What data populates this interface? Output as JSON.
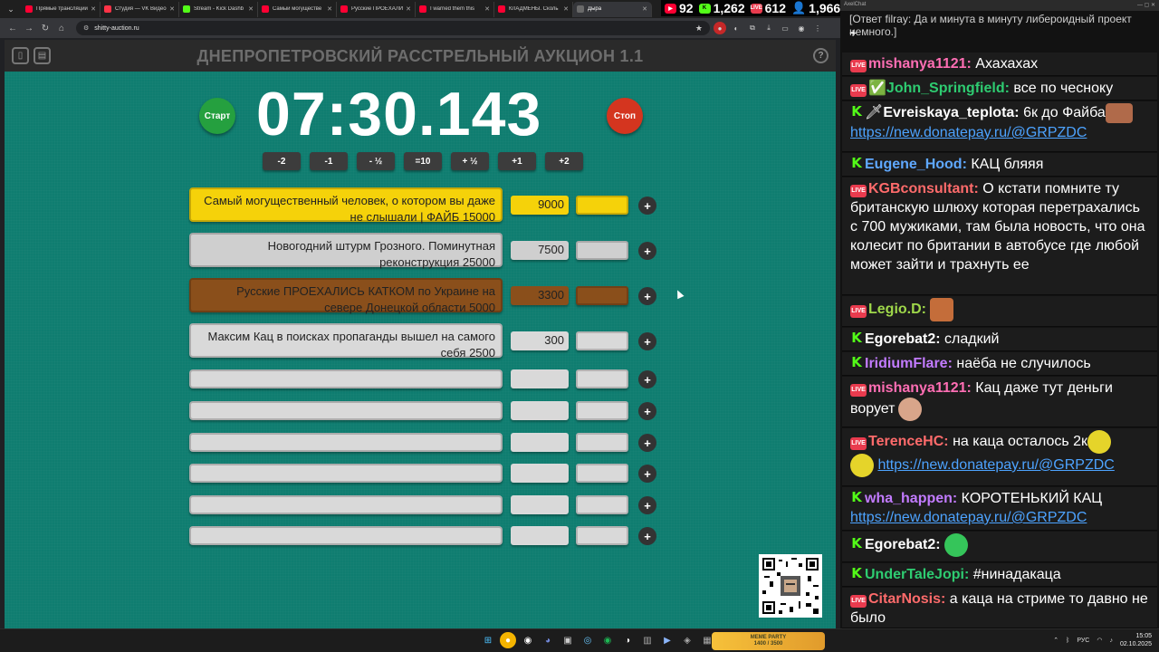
{
  "browser": {
    "tabs": [
      {
        "label": "Прямые трансляции",
        "favicon_color": "#ff0033"
      },
      {
        "label": "Студия — VK Видео",
        "favicon_color": "#ff3347"
      },
      {
        "label": "Stream - Kick Dashb",
        "favicon_color": "#53fc18"
      },
      {
        "label": "Самый могуществе",
        "favicon_color": "#ff0033"
      },
      {
        "label": "Русские ПРОЕХАЛИ",
        "favicon_color": "#ff0033"
      },
      {
        "label": "I warned them this",
        "favicon_color": "#ff0033"
      },
      {
        "label": "КЛАДМЕНЫ. Сколь",
        "favicon_color": "#ff0033"
      },
      {
        "label": "Дыра",
        "favicon_color": "#6a6a6a"
      }
    ],
    "url": "shitty-auction.ru"
  },
  "overlay": {
    "yt_count": "92",
    "kick_count": "1,262",
    "vk_count": "612",
    "total_count": "1,966"
  },
  "auction": {
    "title": "ДНЕПРОПЕТРОВСКИЙ РАССТРЕЛЬНЫЙ АУКЦИОН 1.1",
    "timer": "07:30.143",
    "start_label": "Старт",
    "stop_label": "Стоп",
    "adjust_buttons": [
      "-2",
      "-1",
      "- ½",
      "=10",
      "+ ½",
      "+1",
      "+2"
    ],
    "lots": [
      {
        "name": "Самый могущественный человек, о котором вы даже не слышали | ФАЙБ 15000",
        "amount": "9000",
        "color": "#f5d20a"
      },
      {
        "name": "Новогодний штурм Грозного. Поминутная реконструкция 25000",
        "amount": "7500",
        "color": "#cfcfcf"
      },
      {
        "name": "Русские ПРОЕХАЛИСЬ КАТКОМ по Украине на севере Донецкой области 5000",
        "amount": "3300",
        "color": "#8a4f1b"
      },
      {
        "name": "Максим Кац в поисках пропаганды вышел на самого себя 2500",
        "amount": "300",
        "color": "#d9d9d9"
      }
    ],
    "empty_rows": 6,
    "plus_label": "+"
  },
  "chat": {
    "window_title": "AxelChat",
    "top_line": "[Ответ filray: Да и минута в минуту либероидный проект немного.]",
    "plus_line": "+",
    "live_label": "LIVE",
    "kick_label": "K",
    "messages": [
      {
        "user": "mishanya1121:",
        "text": " Ахахахах",
        "color": "#ff6eb4",
        "platform": "yt"
      },
      {
        "user": "John_Springfield:",
        "text": " все по чесноку",
        "color": "#2ecc71",
        "platform": "yt",
        "pre": "✅"
      },
      {
        "user": "Evreiskaya_teplota:",
        "text": " 6к до Файба",
        "link": "https://new.donatepay.ru/@GRPZDC",
        "color": "#ffffff",
        "platform": "kick",
        "pre": "🗡"
      },
      {
        "user": "Eugene_Hood:",
        "text": " КАЦ бляяя",
        "color": "#5fa8ff",
        "platform": "kick"
      },
      {
        "user": "KGBconsultant:",
        "text": " О кстати помните ту британскую шлюху которая перетрахались с 700 мужиками, там была новость, что она колесит по британии в автобусе где любой может зайти и трахнуть ее",
        "color": "#ff6b6b",
        "platform": "yt"
      },
      {
        "user": "Legio.D:",
        "text": "",
        "color": "#9fd84a",
        "platform": "yt"
      },
      {
        "user": "Egorebat2:",
        "text": " сладкий",
        "color": "#ffffff",
        "platform": "kick"
      },
      {
        "user": "IridiumFlare:",
        "text": " наёба не случилось",
        "color": "#c27bff",
        "platform": "kick"
      },
      {
        "user": "mishanya1121:",
        "text": " Кац даже тут деньги ворует",
        "color": "#ff6eb4",
        "platform": "yt"
      },
      {
        "user": "TerenceHC:",
        "text": " на каца осталось 2к",
        "link": "https://new.donatepay.ru/@GRPZDC",
        "color": "#ff6b6b",
        "platform": "yt"
      },
      {
        "user": "wha_happen:",
        "text": " КОРОТЕНЬКИЙ КАЦ",
        "link": "https://new.donatepay.ru/@GRPZDC",
        "color": "#c27bff",
        "platform": "kick"
      },
      {
        "user": "Egorebat2:",
        "text": "",
        "color": "#ffffff",
        "platform": "kick"
      },
      {
        "user": "UnderTaleJopi:",
        "text": " #нинадакаца",
        "color": "#2ecc71",
        "platform": "kick"
      },
      {
        "user": "CitarNosis:",
        "text": " а каца на стриме то давно не было",
        "color": "#ff6b6b",
        "platform": "yt"
      }
    ]
  },
  "taskbar": {
    "widget_title": "MEME PARTY",
    "widget_value": "1400 / 3500",
    "lang": "РУС",
    "time": "15:05",
    "date": "02.10.2025"
  }
}
